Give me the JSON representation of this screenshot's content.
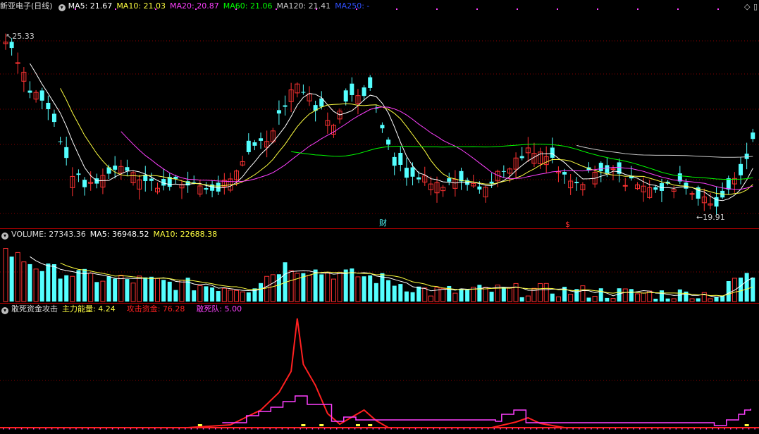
{
  "price_header": {
    "title": "新亚电子(日线)",
    "ma5": "MA5: 21.67",
    "ma10": "MA10: 21.03",
    "ma20": "MA20: 20.87",
    "ma60": "MA60: 21.06",
    "ma120": "MA120: 21.41",
    "ma250": "MA250: -"
  },
  "volume_header": {
    "title": "VOLUME: 27343.36",
    "ma5": "MA5: 36948.52",
    "ma10": "MA10: 22688.38"
  },
  "indicator_header": {
    "title": "敢死资金攻击",
    "main": "主力能量: 4.24",
    "attack": "攻击资金: 76.28",
    "squad": "敢死队: 5.00"
  },
  "annotations": {
    "high": "25.33",
    "low": "19.91",
    "mark_cai": "财",
    "mark_s": "$"
  },
  "colors": {
    "up": "#ff3232",
    "down": "#54ffff",
    "ma5": "#ffffff",
    "ma10": "#ffff40",
    "ma20": "#ff40ff",
    "ma60": "#00ff00",
    "ma120": "#c8c8c8",
    "ma250": "#4060ff",
    "attack": "#ff2020",
    "squad": "#ff40ff",
    "main": "#ffff40"
  },
  "chart_data": [
    {
      "type": "candlestick",
      "title": "新亚电子(日线)",
      "ylim": [
        19.5,
        26.0
      ],
      "high": 25.33,
      "low": 19.91
    },
    {
      "type": "bar",
      "title": "VOLUME"
    },
    {
      "type": "line",
      "title": "敢死资金攻击"
    }
  ]
}
